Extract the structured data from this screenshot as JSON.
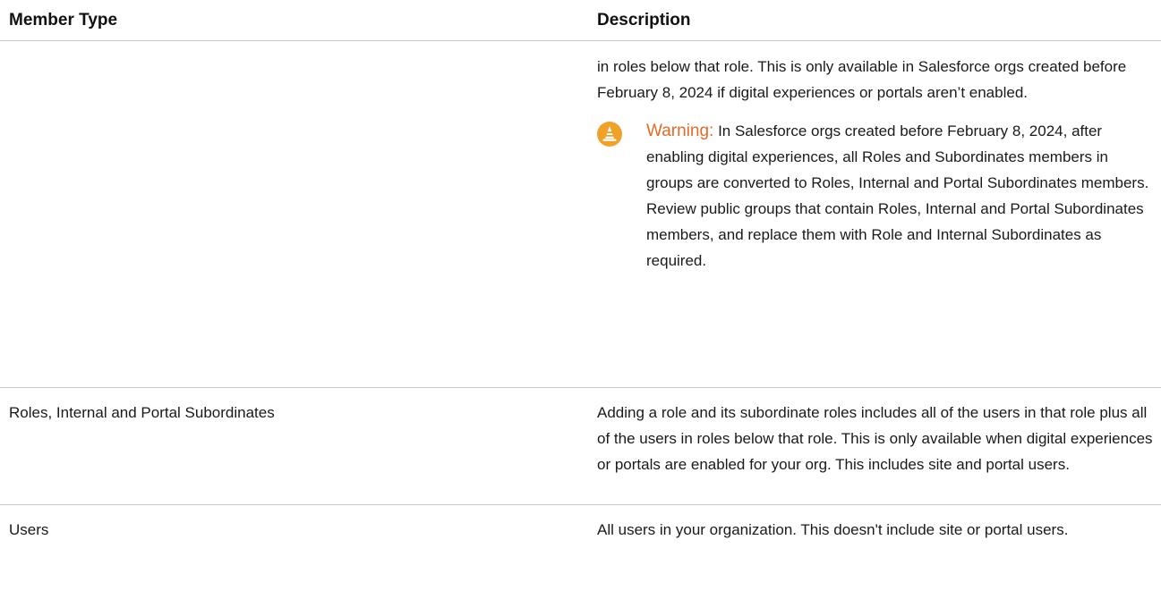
{
  "table": {
    "headers": {
      "member_type": "Member Type",
      "description": "Description"
    },
    "rows": [
      {
        "member_type": "",
        "description": "in roles below that role. This is only available in Salesforce orgs created before February 8, 2024 if digital experiences or portals aren’t enabled.",
        "warning": {
          "label": "Warning:",
          "text": "In Salesforce orgs created before February 8, 2024, after enabling digital experiences, all Roles and Subordinates members in groups are converted to Roles, Internal and Portal Subordinates members. Review public groups that contain Roles, Internal and Portal Subordinates members, and replace them with Role and Internal Subordinates as required."
        }
      },
      {
        "member_type": "Roles, Internal and Portal Subordinates",
        "description": "Adding a role and its subordinate roles includes all of the users in that role plus all of the users in roles below that role. This is only available when digital experiences or portals are enabled for your org. This includes site and portal users."
      },
      {
        "member_type": "Users",
        "description": "All users in your organization. This doesn't include site or portal users."
      }
    ]
  },
  "colors": {
    "warning_label": "#e46b27",
    "warning_icon_bg": "#f0a228",
    "divider": "#c9c9c9"
  },
  "icons": {
    "warning": "warning-cone-icon"
  }
}
